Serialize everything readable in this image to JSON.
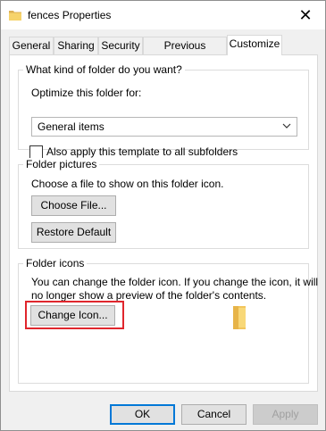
{
  "window": {
    "title": "fences Properties",
    "close_glyph": "✕"
  },
  "tabs": [
    {
      "label": "General"
    },
    {
      "label": "Sharing"
    },
    {
      "label": "Security"
    },
    {
      "label": "Previous Versions"
    },
    {
      "label": "Customize",
      "active": true
    }
  ],
  "folder_type": {
    "group_title": "What kind of folder do you want?",
    "optimize_label": "Optimize this folder for:",
    "selected_value": "General items",
    "apply_all_label": "Also apply this template to all subfolders",
    "apply_all_checked": false
  },
  "folder_pictures": {
    "group_title": "Folder pictures",
    "description": "Choose a file to show on this folder icon.",
    "choose_file_label": "Choose File...",
    "restore_default_label": "Restore Default"
  },
  "folder_icons": {
    "group_title": "Folder icons",
    "description_line1": "You can change the folder icon. If you change the icon, it will",
    "description_line2": "no longer show a preview of the folder's contents.",
    "change_icon_label": "Change Icon..."
  },
  "footer": {
    "ok_label": "OK",
    "cancel_label": "Cancel",
    "apply_label": "Apply"
  },
  "colors": {
    "highlight": "#e0262d",
    "folder": "#f2c55c",
    "accent": "#0078d7"
  },
  "icons": {
    "title": "folder-icon",
    "preview": "folder-icon",
    "dropdown": "chevron-down-icon",
    "close": "close-icon"
  }
}
